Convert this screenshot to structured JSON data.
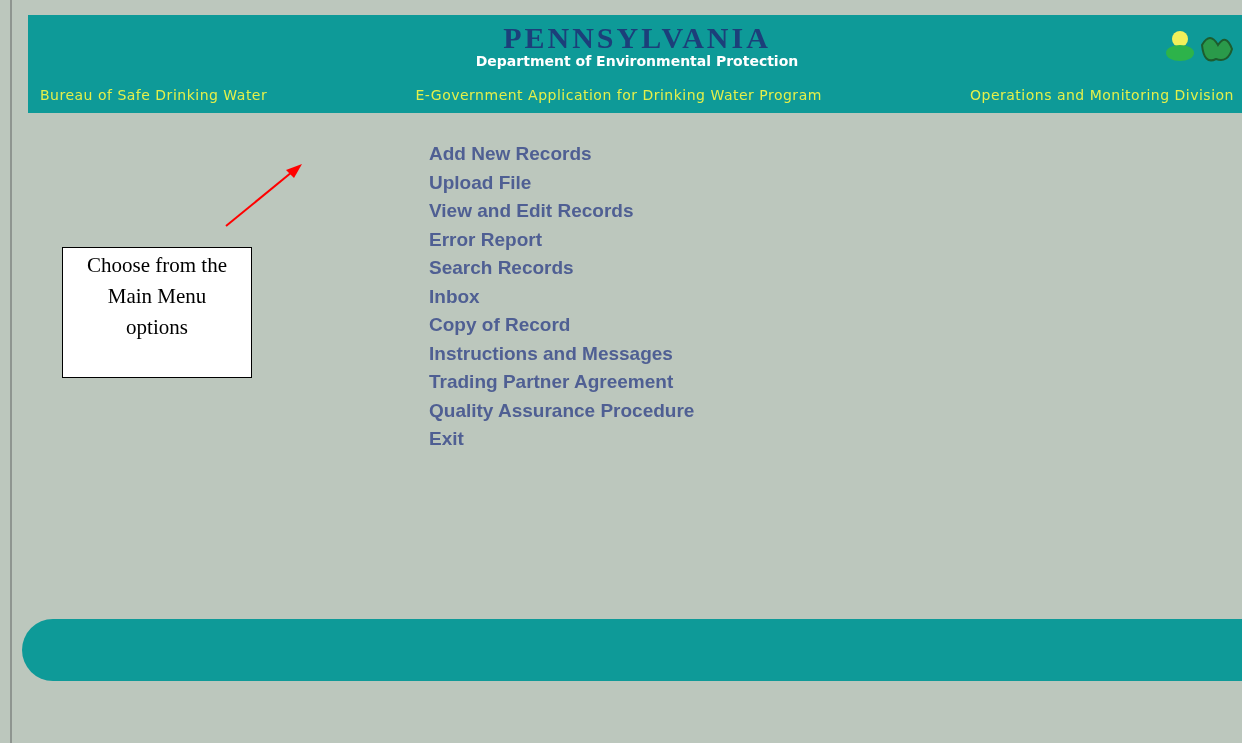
{
  "header": {
    "state_banner": "PENNSYLVANIA",
    "department": "Department of Environmental Protection",
    "bureau": "Bureau of Safe Drinking Water",
    "application": "E-Government Application for Drinking Water Program",
    "division": "Operations and Monitoring Division"
  },
  "menu": [
    {
      "label": "Add New Records"
    },
    {
      "label": "Upload File"
    },
    {
      "label": "View and Edit Records"
    },
    {
      "label": "Error Report"
    },
    {
      "label": "Search Records"
    },
    {
      "label": "Inbox"
    },
    {
      "label": "Copy of Record"
    },
    {
      "label": "Instructions and Messages"
    },
    {
      "label": "Trading Partner Agreement"
    },
    {
      "label": "Quality Assurance Procedure"
    },
    {
      "label": "Exit"
    }
  ],
  "callout": {
    "text": "Choose from the Main Menu options"
  }
}
